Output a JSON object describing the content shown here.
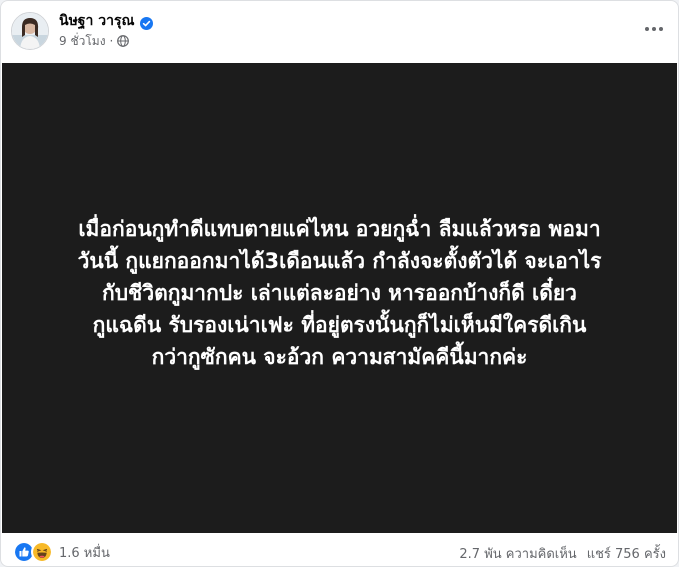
{
  "post": {
    "author": "นิษฐา วารุณ",
    "time": "9 ชั่วโมง",
    "privacy_icon": "globe-icon",
    "verified_icon": "verified-badge-icon",
    "more_icon": "more-options-icon",
    "background_color": "#1c1c1c",
    "text_lines": [
      "เมื่อก่อนกูทำดีแทบตายแค่ไหน อวยกูฉ่ำ ลืมแล้วหรอ พอมา",
      "วันนี้ กูแยกออกมาได้3เดือนแล้ว กำลังจะตั้งตัวได้ จะเอาไร",
      "กับชีวิตกูมากปะ เล่าแต่ละอย่าง หารออกบ้างก็ดี เดี๋ยว",
      "กูแฉดีน รับรองเน่าเฟะ ที่อยู่ตรงนั้นกูก็ไม่เห็นมีใครดีเกิน",
      "กว่ากูซักคน จะอ้วก ความสามัคคีนี้มากค่ะ"
    ]
  },
  "footer": {
    "reaction_icons": [
      "like-icon",
      "haha-icon"
    ],
    "reaction_count": "1.6 หมื่น",
    "comments": "2.7 พัน ความคิดเห็น",
    "shares": "แชร์ 756 ครั้ง"
  },
  "colors": {
    "like": "#1877f2",
    "haha": "#f7b928",
    "verified": "#1877f2",
    "secondary_text": "#65676b"
  }
}
